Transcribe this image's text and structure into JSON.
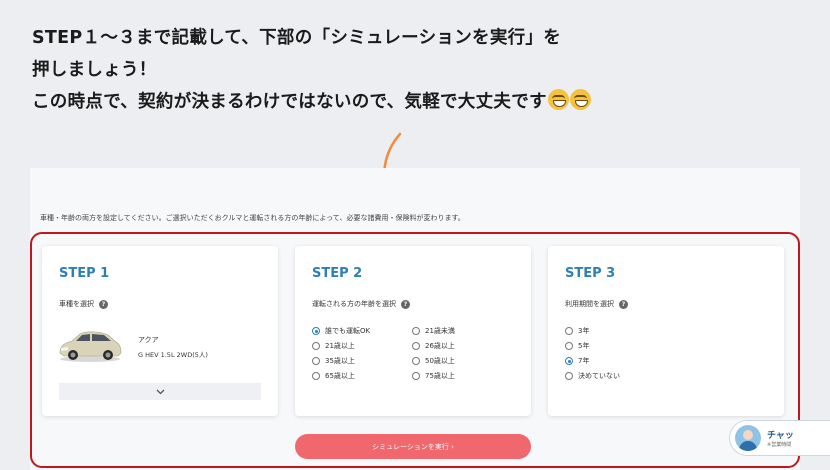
{
  "instructions": {
    "line1": "STEP１～３まで記載して、下部の「シミュレーションを実行」を",
    "line2": "押しましょう！",
    "line3": "この時点で、契約が決まるわけではないので、気軽で大丈夫です"
  },
  "notice": "車種・年齢の両方を設定してください。ご選択いただくおクルマと運転される方の年齢によって、必要な諸費用・保険料が変わります。",
  "step1": {
    "title": "STEP 1",
    "label": "車種を選択",
    "car_name": "アクア",
    "car_grade": "G HEV 1.5L 2WD(5人)"
  },
  "step2": {
    "title": "STEP 2",
    "label": "運転される方の年齢を選択",
    "options": [
      "誰でも運転OK",
      "21歳未満",
      "21歳以上",
      "26歳以上",
      "35歳以上",
      "50歳以上",
      "65歳以上",
      "75歳以上"
    ],
    "selected": "誰でも運転OK"
  },
  "step3": {
    "title": "STEP 3",
    "label": "利用期間を選択",
    "options": [
      "3年",
      "5年",
      "7年",
      "決めていない"
    ],
    "selected": "7年"
  },
  "simulate_button": "シミュレーションを実行 ›",
  "chat": {
    "title": "チャッ",
    "subtitle": "※営業時間"
  },
  "icons": {
    "help": "question-circle-icon",
    "dropdown": "chevron-down-icon",
    "arrow": "curved-arrow-down-icon",
    "emoji": "grinning-face-icon"
  },
  "colors": {
    "accent_blue": "#2c7fb8",
    "highlight_red": "#c0161e",
    "button_pink": "#f0676e",
    "arrow_orange": "#f28c3a"
  }
}
